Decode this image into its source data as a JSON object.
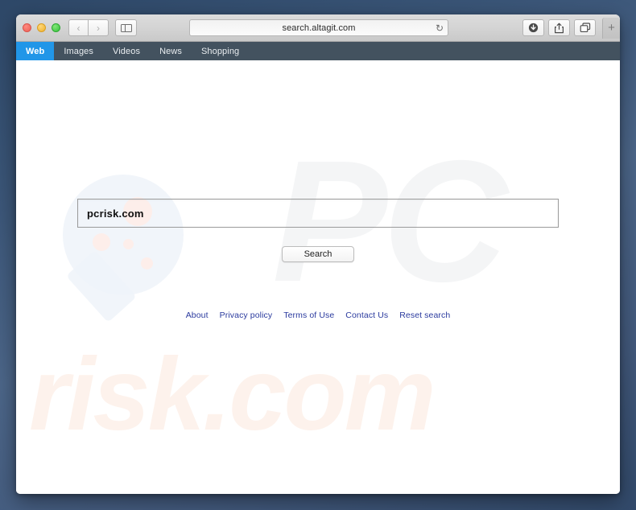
{
  "window": {
    "traffic_lights": [
      {
        "name": "close",
        "color": "#ec5f55"
      },
      {
        "name": "minimize",
        "color": "#eeb12b"
      },
      {
        "name": "zoom",
        "color": "#35c23b"
      }
    ]
  },
  "toolbar": {
    "back_glyph": "‹",
    "forward_glyph": "›",
    "sidebar_icon": "sidebar-icon",
    "url": "search.altagit.com",
    "reload_glyph": "↻",
    "download_icon": "download-icon",
    "share_icon": "share-icon",
    "tabs_icon": "tabs-icon",
    "new_tab_label": "+"
  },
  "navbar": {
    "items": [
      {
        "label": "Web",
        "active": true
      },
      {
        "label": "Images",
        "active": false
      },
      {
        "label": "Videos",
        "active": false
      },
      {
        "label": "News",
        "active": false
      },
      {
        "label": "Shopping",
        "active": false
      }
    ]
  },
  "page": {
    "watermark_pc": "PC",
    "watermark_risk": "risk.com",
    "search": {
      "value": "pcrisk.com",
      "placeholder": "",
      "button_label": "Search"
    },
    "footer": {
      "links": [
        {
          "label": "About"
        },
        {
          "label": "Privacy policy"
        },
        {
          "label": "Terms of Use"
        },
        {
          "label": "Contact Us"
        },
        {
          "label": "Reset search"
        }
      ]
    }
  },
  "colors": {
    "navbar_bg": "#43525f",
    "navbar_active": "#2196e8",
    "link": "#2a3a9e",
    "desktop": "#405a7d"
  }
}
